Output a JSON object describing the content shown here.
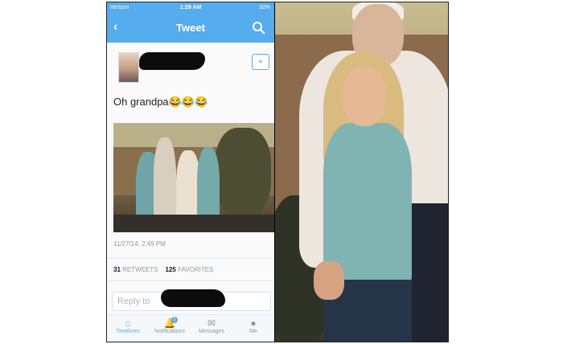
{
  "status_bar": {
    "carrier": "Verizon",
    "time": "1:29 AM",
    "battery": "32%"
  },
  "nav": {
    "back_icon": "chevron-left-icon",
    "title": "Tweet",
    "search_icon": "search-icon"
  },
  "tweet": {
    "text": "Oh grandpa😂😂😂",
    "follow_icon": "follow-user-icon",
    "timestamp": "11/27/14, 2:49 PM",
    "retweets": "31",
    "retweets_label": "RETWEETS",
    "favorites": "125",
    "favorites_label": "FAVORITES",
    "reply_placeholder": "Reply to"
  },
  "tabbar": {
    "items": [
      {
        "label": "Timelines",
        "icon": "home-icon"
      },
      {
        "label": "Notifications",
        "icon": "bell-icon",
        "badge": "1"
      },
      {
        "label": "Messages",
        "icon": "envelope-icon"
      },
      {
        "label": "Me",
        "icon": "person-icon"
      }
    ]
  },
  "colors": {
    "accent": "#55acee",
    "text": "#14171a",
    "muted": "#8899a6"
  }
}
